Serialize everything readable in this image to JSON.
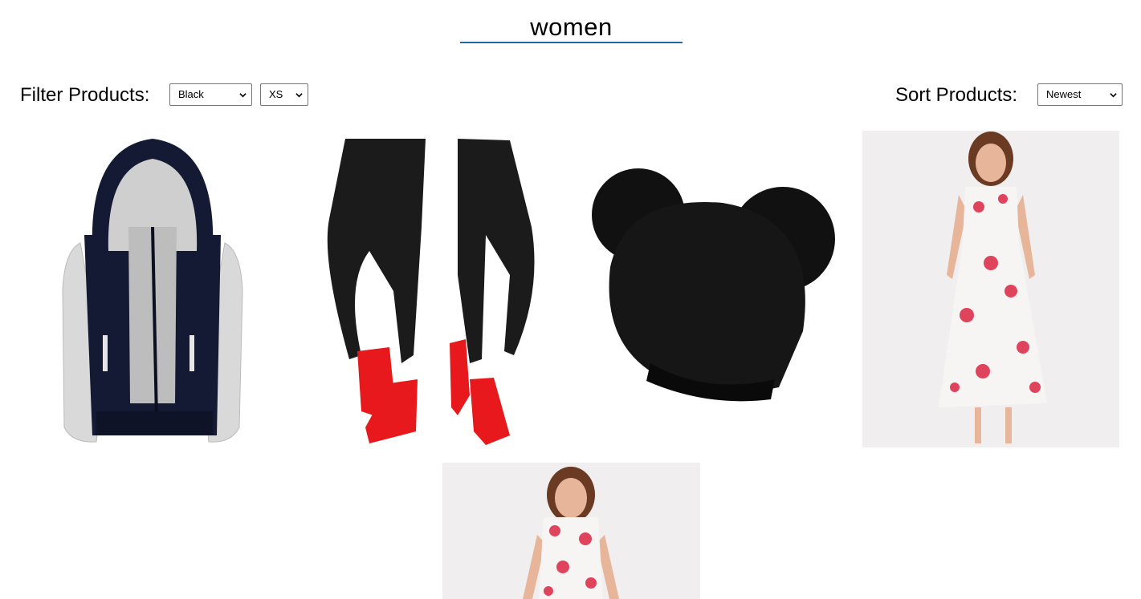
{
  "header": {
    "title": "women"
  },
  "filter": {
    "label": "Filter Products:",
    "color_value": "Black",
    "size_value": "XS"
  },
  "sort": {
    "label": "Sort Products:",
    "value": "Newest"
  },
  "products": [
    {
      "kind": "hooded jacket",
      "icon": "jacket-image"
    },
    {
      "kind": "black jeans with red sneakers",
      "icon": "jeans-image"
    },
    {
      "kind": "black pom-pom beanie",
      "icon": "beanie-image"
    },
    {
      "kind": "floral maxi dress",
      "icon": "dress-image"
    },
    {
      "kind": "floral dress",
      "icon": "dress-image"
    }
  ],
  "colors": {
    "title_underline": "#1f6aa5",
    "jacket_navy": "#141a33",
    "jacket_grey": "#d9d9d9",
    "jeans_black": "#1b1b1b",
    "sneaker_red": "#e8191c",
    "dress_white": "#f7f4f4",
    "flower_pink": "#e0435c"
  }
}
